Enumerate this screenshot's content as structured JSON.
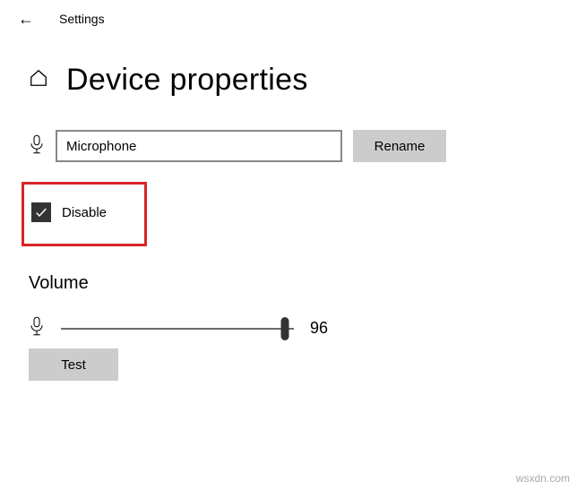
{
  "titlebar": {
    "label": "Settings"
  },
  "header": {
    "title": "Device properties"
  },
  "device": {
    "name_value": "Microphone",
    "rename_label": "Rename"
  },
  "disable": {
    "checked": true,
    "label": "Disable"
  },
  "volume": {
    "heading": "Volume",
    "value": 96,
    "value_text": "96",
    "test_label": "Test"
  },
  "watermark": "wsxdn.com"
}
